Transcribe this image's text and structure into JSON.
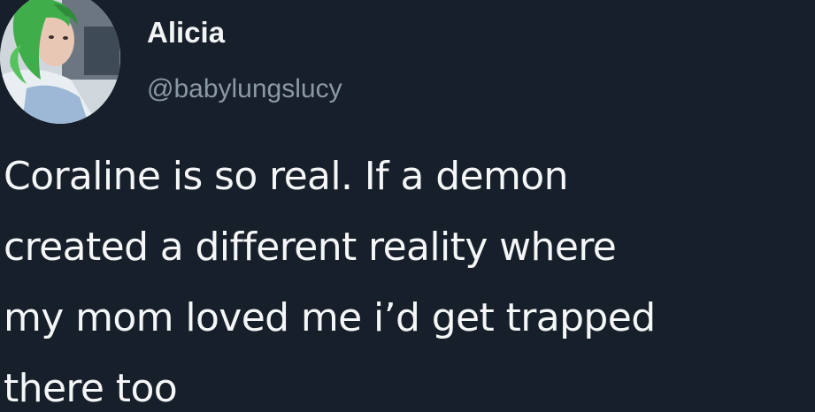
{
  "user": {
    "display_name": "Alicia",
    "handle": "@babylungslucy",
    "avatar_icon": "profile-photo-green-hair"
  },
  "tweet": {
    "lines": [
      "Coraline is so real. If a demon",
      "created a different reality where",
      "my mom loved me i’d get trapped",
      "there too"
    ]
  },
  "colors": {
    "background": "#161f2a",
    "text": "#f4f6f7",
    "handle": "#8b98a5"
  }
}
